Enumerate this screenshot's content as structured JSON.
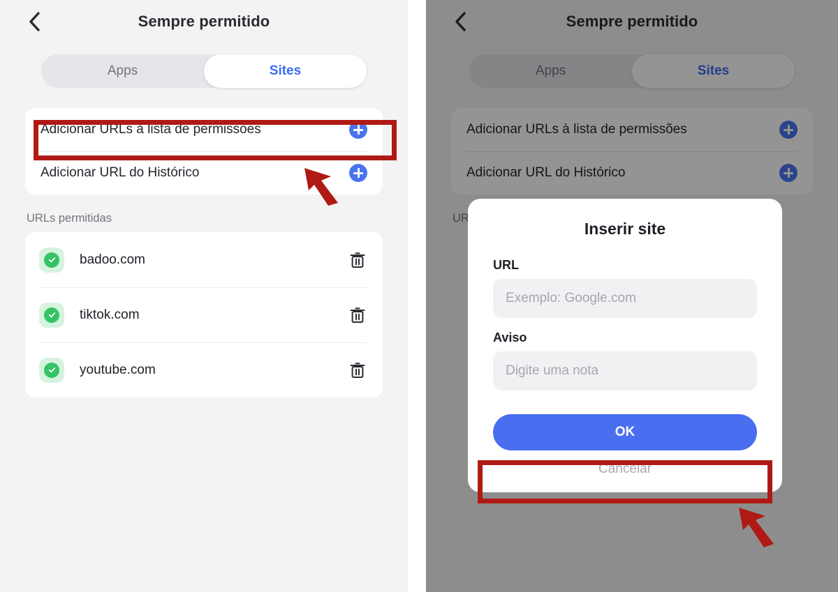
{
  "screen": {
    "nav": {
      "back_icon": "chevron-left-icon",
      "title": "Sempre permitido"
    },
    "tabs": [
      {
        "label": "Apps",
        "active": false
      },
      {
        "label": "Sites",
        "active": true
      }
    ],
    "add_rows": [
      {
        "label": "Adicionar URLs à lista de permissões",
        "icon": "plus-circle-icon"
      },
      {
        "label": "Adicionar URL do Histórico",
        "icon": "plus-circle-icon"
      }
    ],
    "allowed_section_label": "URLs permitidas",
    "allowed_urls": [
      {
        "name": "badoo.com",
        "status_icon": "check-circle-icon",
        "delete_icon": "trash-icon"
      },
      {
        "name": "tiktok.com",
        "status_icon": "check-circle-icon",
        "delete_icon": "trash-icon"
      },
      {
        "name": "youtube.com",
        "status_icon": "check-circle-icon",
        "delete_icon": "trash-icon"
      }
    ]
  },
  "dialog": {
    "title": "Inserir site",
    "url_label": "URL",
    "url_value": "",
    "url_placeholder": "Exemplo: Google.com",
    "note_label": "Aviso",
    "note_value": "",
    "note_placeholder": "Digite uma nota",
    "ok_label": "OK",
    "cancel_label": "Cancelar"
  },
  "annotations": {
    "highlight_color": "#b01a14",
    "arrow_icon": "arrow-up-left-icon",
    "left_highlight_target": "Adicionar URLs à lista de permissões",
    "right_highlight_target": "OK"
  },
  "colors": {
    "accent_blue": "#4a6ef0",
    "tab_active_text": "#3b6bf0",
    "success_green": "#34c363",
    "success_green_bg": "#d6f3df",
    "page_bg": "#f3f3f3",
    "card_bg": "#ffffff",
    "highlight_red": "#b01a14"
  }
}
